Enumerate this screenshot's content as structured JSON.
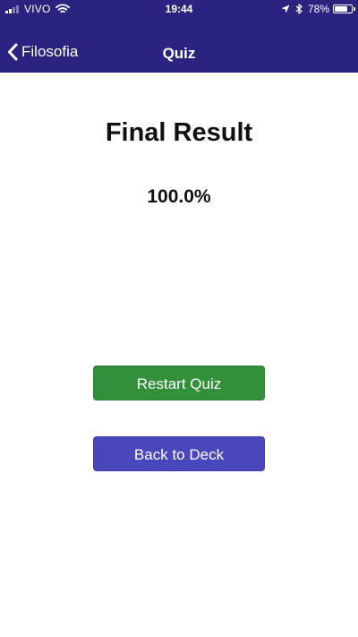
{
  "status_bar": {
    "carrier": "VIVO",
    "time": "19:44",
    "battery_percent": "78%",
    "battery_level": 0.78,
    "signal_bars": 2,
    "icons": [
      "signal-icon",
      "wifi-icon",
      "location-arrow-icon",
      "bluetooth-icon",
      "battery-icon"
    ]
  },
  "nav": {
    "back_label": "Filosofia",
    "title": "Quiz",
    "background_color": "#2a2380"
  },
  "result": {
    "title": "Final Result",
    "score": "100.0%"
  },
  "buttons": {
    "restart_label": "Restart Quiz",
    "restart_color": "#33903a",
    "back_to_deck_label": "Back to Deck",
    "back_to_deck_color": "#4a47bc"
  }
}
